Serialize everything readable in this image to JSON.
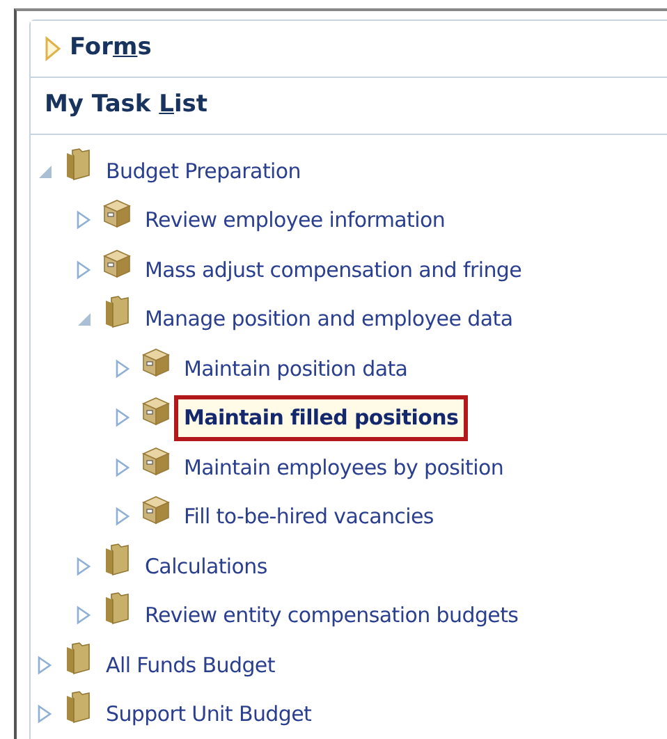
{
  "forms_header": {
    "label_parts": [
      "For",
      "m",
      "s"
    ],
    "expanded": false
  },
  "task_list_header": {
    "label_parts": [
      "My Task ",
      "L",
      "ist"
    ]
  },
  "tree": [
    {
      "label": "Budget Preparation",
      "kind": "folder",
      "expanded": true,
      "selected": false,
      "children": [
        {
          "label": "Review employee information",
          "kind": "task",
          "expanded": false,
          "selected": false
        },
        {
          "label": "Mass adjust compensation and fringe",
          "kind": "task",
          "expanded": false,
          "selected": false
        },
        {
          "label": "Manage position and employee data",
          "kind": "folder",
          "expanded": true,
          "selected": false,
          "children": [
            {
              "label": "Maintain position data",
              "kind": "task",
              "expanded": false,
              "selected": false
            },
            {
              "label": "Maintain filled positions",
              "kind": "task",
              "expanded": false,
              "selected": true
            },
            {
              "label": "Maintain employees by position",
              "kind": "task",
              "expanded": false,
              "selected": false
            },
            {
              "label": "Fill to-be-hired vacancies",
              "kind": "task",
              "expanded": false,
              "selected": false
            }
          ]
        },
        {
          "label": "Calculations",
          "kind": "folder",
          "expanded": false,
          "selected": false
        },
        {
          "label": "Review entity compensation budgets",
          "kind": "folder",
          "expanded": false,
          "selected": false
        }
      ]
    },
    {
      "label": "All Funds Budget",
      "kind": "folder",
      "expanded": false,
      "selected": false
    },
    {
      "label": "Support Unit Budget",
      "kind": "folder",
      "expanded": false,
      "selected": false
    }
  ]
}
